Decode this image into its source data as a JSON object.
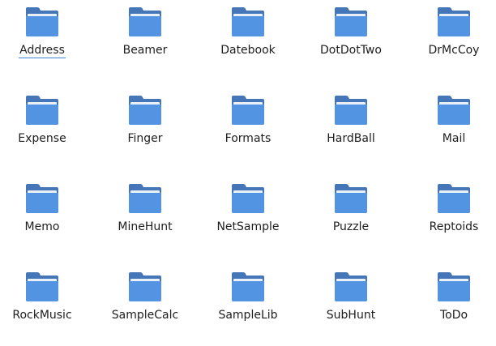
{
  "folder_colors": {
    "back": "#4576b7",
    "paper": "#e9f0f8",
    "front": "#5294e2"
  },
  "icon_name": "folder-icon",
  "items": [
    {
      "label": "Address",
      "focused": true
    },
    {
      "label": "Beamer"
    },
    {
      "label": "Datebook"
    },
    {
      "label": "DotDotTwo"
    },
    {
      "label": "DrMcCoy"
    },
    {
      "label": "Expense"
    },
    {
      "label": "Finger"
    },
    {
      "label": "Formats"
    },
    {
      "label": "HardBall"
    },
    {
      "label": "Mail"
    },
    {
      "label": "Memo"
    },
    {
      "label": "MineHunt"
    },
    {
      "label": "NetSample"
    },
    {
      "label": "Puzzle"
    },
    {
      "label": "Reptoids"
    },
    {
      "label": "RockMusic"
    },
    {
      "label": "SampleCalc"
    },
    {
      "label": "SampleLib"
    },
    {
      "label": "SubHunt"
    },
    {
      "label": "ToDo"
    }
  ]
}
